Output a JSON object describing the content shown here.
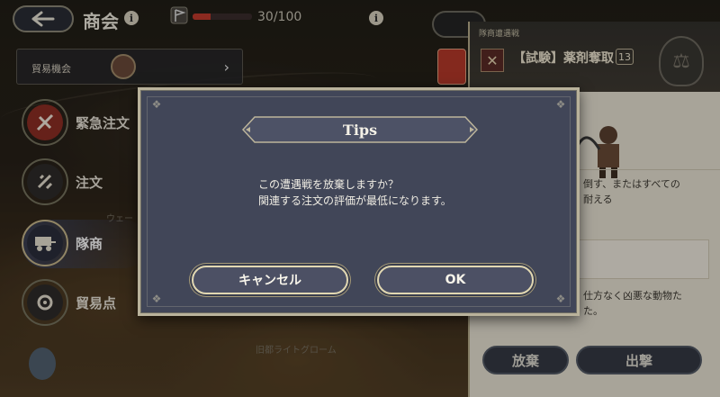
{
  "header": {
    "title": "商会",
    "stamina_text": "30/100",
    "stamina_fraction": 0.3
  },
  "sidebar": {
    "opportunity_label": "貿易機会",
    "items": [
      {
        "label": "緊急注文"
      },
      {
        "label": "注文"
      },
      {
        "label": "隊商"
      },
      {
        "label": "貿易点"
      }
    ]
  },
  "map": {
    "labels": [
      "ウェー",
      "旧都ライトグローム"
    ]
  },
  "panel": {
    "tag": "隊商遭遇戦",
    "mission_name": "【試験】薬剤奪取",
    "mission_level": "13",
    "text_lines_1": [
      "倒す、またはすべての",
      "耐える"
    ],
    "text_lines_2": [
      "仕方なく凶悪な動物た",
      "た。"
    ],
    "abandon_label": "放棄",
    "sortie_label": "出撃"
  },
  "dialog": {
    "title": "Tips",
    "message_lines": [
      "この遭遇戦を放棄しますか？",
      "関連する注文の評価が最低になります。"
    ],
    "cancel_label": "キャンセル",
    "ok_label": "OK"
  },
  "colors": {
    "stamina_fill": "#c33b2d",
    "dialog_bg": "#414658",
    "dialog_frame": "#b9b29b",
    "button_border": "#e2d8b2"
  }
}
